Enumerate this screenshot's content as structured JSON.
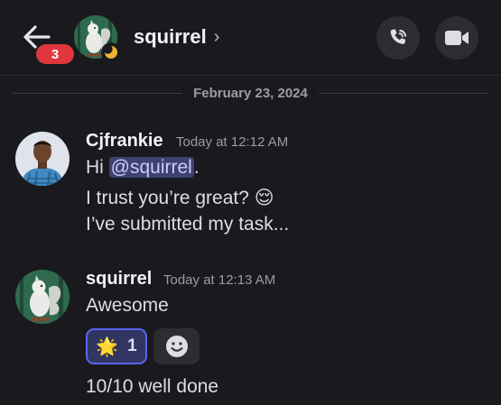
{
  "header": {
    "unread_count": "3",
    "channel_name": "squirrel",
    "chevron": "›",
    "icons": {
      "back": "arrow-left-icon",
      "call": "phone-call-icon",
      "video": "video-camera-icon",
      "status": "idle-moon-icon"
    }
  },
  "divider": {
    "date": "February 23, 2024"
  },
  "messages": [
    {
      "author": "Cjfrankie",
      "timestamp": "Today at 12:12 AM",
      "lines": [
        {
          "prefix": "Hi ",
          "mention": "@squirrel",
          "suffix": "."
        },
        {
          "text": "I trust you’re great? 😌"
        },
        {
          "text": "I’ve submitted my task..."
        }
      ]
    },
    {
      "author": "squirrel",
      "timestamp": "Today at 12:13 AM",
      "lines": [
        {
          "text": "Awesome"
        },
        {
          "text": "10/10 well done"
        }
      ],
      "reaction": {
        "emoji": "🌟",
        "count": "1"
      }
    }
  ],
  "colors": {
    "background": "#1a1a1e",
    "badge": "#e0363e",
    "mention_bg": "#3d4273",
    "reaction_border": "#5865f2",
    "status_idle": "#f0b232"
  }
}
